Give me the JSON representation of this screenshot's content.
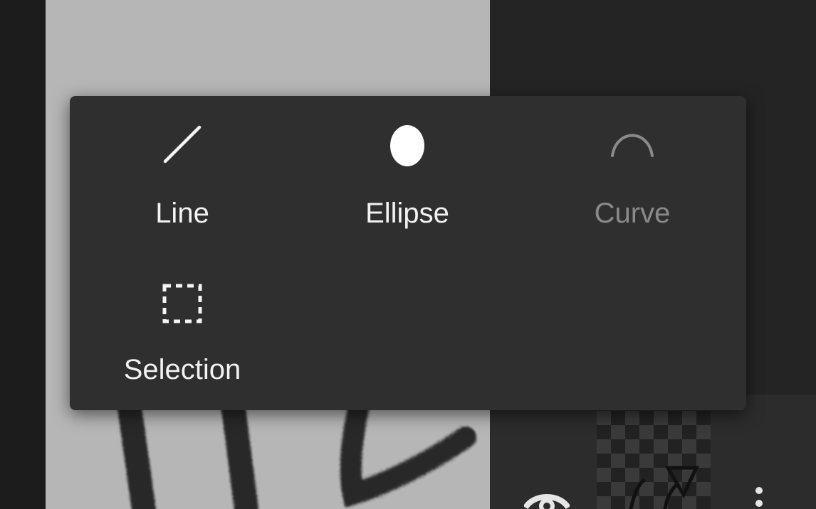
{
  "tools": {
    "line": {
      "label": "Line",
      "icon": "line-icon",
      "enabled": true
    },
    "ellipse": {
      "label": "Ellipse",
      "icon": "ellipse-icon",
      "enabled": true
    },
    "curve": {
      "label": "Curve",
      "icon": "curve-icon",
      "enabled": false
    },
    "selection": {
      "label": "Selection",
      "icon": "selection-icon",
      "enabled": true
    }
  },
  "colors": {
    "popup_background": "#2f2f2f",
    "label_enabled": "#f2f2f2",
    "label_disabled": "#8a8a8a",
    "canvas_background": "#b6b6b6"
  },
  "layer_panel": {
    "icons": [
      "eye-icon",
      "more-icon"
    ]
  }
}
